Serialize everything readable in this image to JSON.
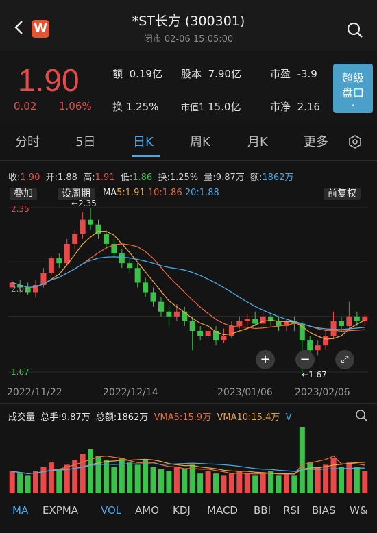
{
  "header": {
    "title": "*ST长方 (300301)",
    "subtitle": "闭市 02-06 15:05:00",
    "logo": "W"
  },
  "quote": {
    "price": "1.90",
    "change": "0.02",
    "change_pct": "1.06%",
    "fields": [
      {
        "k": "额",
        "v": "0.19亿"
      },
      {
        "k": "股本",
        "v": "7.90亿"
      },
      {
        "k": "市盈",
        "v": "-3.9"
      },
      {
        "k": "换",
        "v": "1.25%"
      },
      {
        "k": "市值1",
        "v": "15.0亿"
      },
      {
        "k": "市净",
        "v": "2.16"
      }
    ],
    "super_btn": [
      "超级",
      "盘口"
    ]
  },
  "tabs": [
    "分时",
    "5日",
    "日K",
    "周K",
    "月K",
    "更多"
  ],
  "active_tab": "日K",
  "ohlc": {
    "close_k": "收:",
    "close_v": "1.90",
    "open_k": "开:",
    "open_v": "1.88",
    "high_k": "高:",
    "high_v": "1.91",
    "low_k": "低:",
    "low_v": "1.86",
    "turn_k": "换:",
    "turn_v": "1.25%",
    "vol_k": "量:",
    "vol_v": "9.87万",
    "amt_k": "额:",
    "amt_v": "1862万"
  },
  "chart_controls": {
    "overlay": "叠加",
    "period": "设周期",
    "ma_label": "MA",
    "ma5": "5:1.91",
    "ma10": "10:1.86",
    "ma20": "20:1.88",
    "fq": "前复权"
  },
  "price_axis": {
    "top": "2.35",
    "mid": "2.01",
    "bottom": "1.67"
  },
  "annotations": {
    "high": "2.35",
    "low": "1.67"
  },
  "dates": [
    "2022/11/22",
    "2022/12/14",
    "2023/01/06",
    "2023/02/06"
  ],
  "volume": {
    "title": "成交量",
    "total_hand": "总手:9.87万",
    "total_amt": "总额:1862万",
    "vma5": "VMA5:15.9万",
    "vma10": "VMA10:15.4万",
    "v": "V"
  },
  "indicators": [
    "MA",
    "EXPMA",
    "VOL",
    "AMO",
    "KDJ",
    "MACD",
    "BBI",
    "RSI",
    "BIAS",
    "W&"
  ],
  "colors": {
    "up": "#e84a4a",
    "down": "#3bc24a",
    "ma5": "#e8a43a",
    "ma10": "#e86a3a",
    "ma20": "#4aa8e8"
  },
  "chart_data": {
    "type": "candlestick",
    "y_range": [
      1.67,
      2.35
    ],
    "candles": [
      [
        2.02,
        2.04,
        2.0,
        2.05
      ],
      [
        2.03,
        2.02,
        2.0,
        2.05
      ],
      [
        2.02,
        2.0,
        1.99,
        2.04
      ],
      [
        2.0,
        2.03,
        1.98,
        2.05
      ],
      [
        2.03,
        2.08,
        2.02,
        2.1
      ],
      [
        2.08,
        2.14,
        2.07,
        2.15
      ],
      [
        2.14,
        2.12,
        2.1,
        2.16
      ],
      [
        2.12,
        2.2,
        2.11,
        2.22
      ],
      [
        2.2,
        2.24,
        2.18,
        2.26
      ],
      [
        2.24,
        2.3,
        2.22,
        2.33
      ],
      [
        2.3,
        2.28,
        2.26,
        2.35
      ],
      [
        2.28,
        2.24,
        2.22,
        2.3
      ],
      [
        2.24,
        2.2,
        2.18,
        2.26
      ],
      [
        2.2,
        2.16,
        2.14,
        2.22
      ],
      [
        2.16,
        2.12,
        2.1,
        2.18
      ],
      [
        2.12,
        2.1,
        2.08,
        2.14
      ],
      [
        2.1,
        2.04,
        2.02,
        2.12
      ],
      [
        2.04,
        2.0,
        1.98,
        2.06
      ],
      [
        2.0,
        1.96,
        1.94,
        2.02
      ],
      [
        1.96,
        1.92,
        1.9,
        1.98
      ],
      [
        1.92,
        1.9,
        1.86,
        1.94
      ],
      [
        1.9,
        1.92,
        1.88,
        1.95
      ],
      [
        1.92,
        1.88,
        1.86,
        1.94
      ],
      [
        1.88,
        1.84,
        1.76,
        1.9
      ],
      [
        1.84,
        1.82,
        1.8,
        1.86
      ],
      [
        1.82,
        1.84,
        1.8,
        1.86
      ],
      [
        1.84,
        1.8,
        1.78,
        1.86
      ],
      [
        1.8,
        1.82,
        1.79,
        1.85
      ],
      [
        1.82,
        1.86,
        1.81,
        1.88
      ],
      [
        1.86,
        1.88,
        1.85,
        1.9
      ],
      [
        1.88,
        1.89,
        1.86,
        1.91
      ],
      [
        1.89,
        1.87,
        1.86,
        1.92
      ],
      [
        1.87,
        1.9,
        1.86,
        1.92
      ],
      [
        1.9,
        1.88,
        1.86,
        1.91
      ],
      [
        1.88,
        1.86,
        1.84,
        1.9
      ],
      [
        1.86,
        1.88,
        1.84,
        1.89
      ],
      [
        1.88,
        1.87,
        1.84,
        1.9
      ],
      [
        1.87,
        1.8,
        1.67,
        1.88
      ],
      [
        1.8,
        1.76,
        1.7,
        1.82
      ],
      [
        1.76,
        1.78,
        1.74,
        1.8
      ],
      [
        1.78,
        1.82,
        1.76,
        1.84
      ],
      [
        1.82,
        1.88,
        1.81,
        1.92
      ],
      [
        1.88,
        1.86,
        1.84,
        1.9
      ],
      [
        1.86,
        1.9,
        1.85,
        1.96
      ],
      [
        1.9,
        1.88,
        1.86,
        1.92
      ],
      [
        1.88,
        1.9,
        1.86,
        1.91
      ]
    ],
    "volume": [
      10,
      9,
      8,
      10,
      12,
      14,
      11,
      13,
      15,
      18,
      20,
      17,
      15,
      12,
      16,
      14,
      13,
      15,
      12,
      11,
      10,
      12,
      11,
      13,
      9,
      10,
      9,
      8,
      9,
      10,
      9,
      8,
      9,
      10,
      8,
      9,
      8,
      30,
      14,
      12,
      13,
      16,
      12,
      14,
      12,
      10
    ],
    "annotations": {
      "high": "2.35",
      "low": "1.67"
    }
  }
}
